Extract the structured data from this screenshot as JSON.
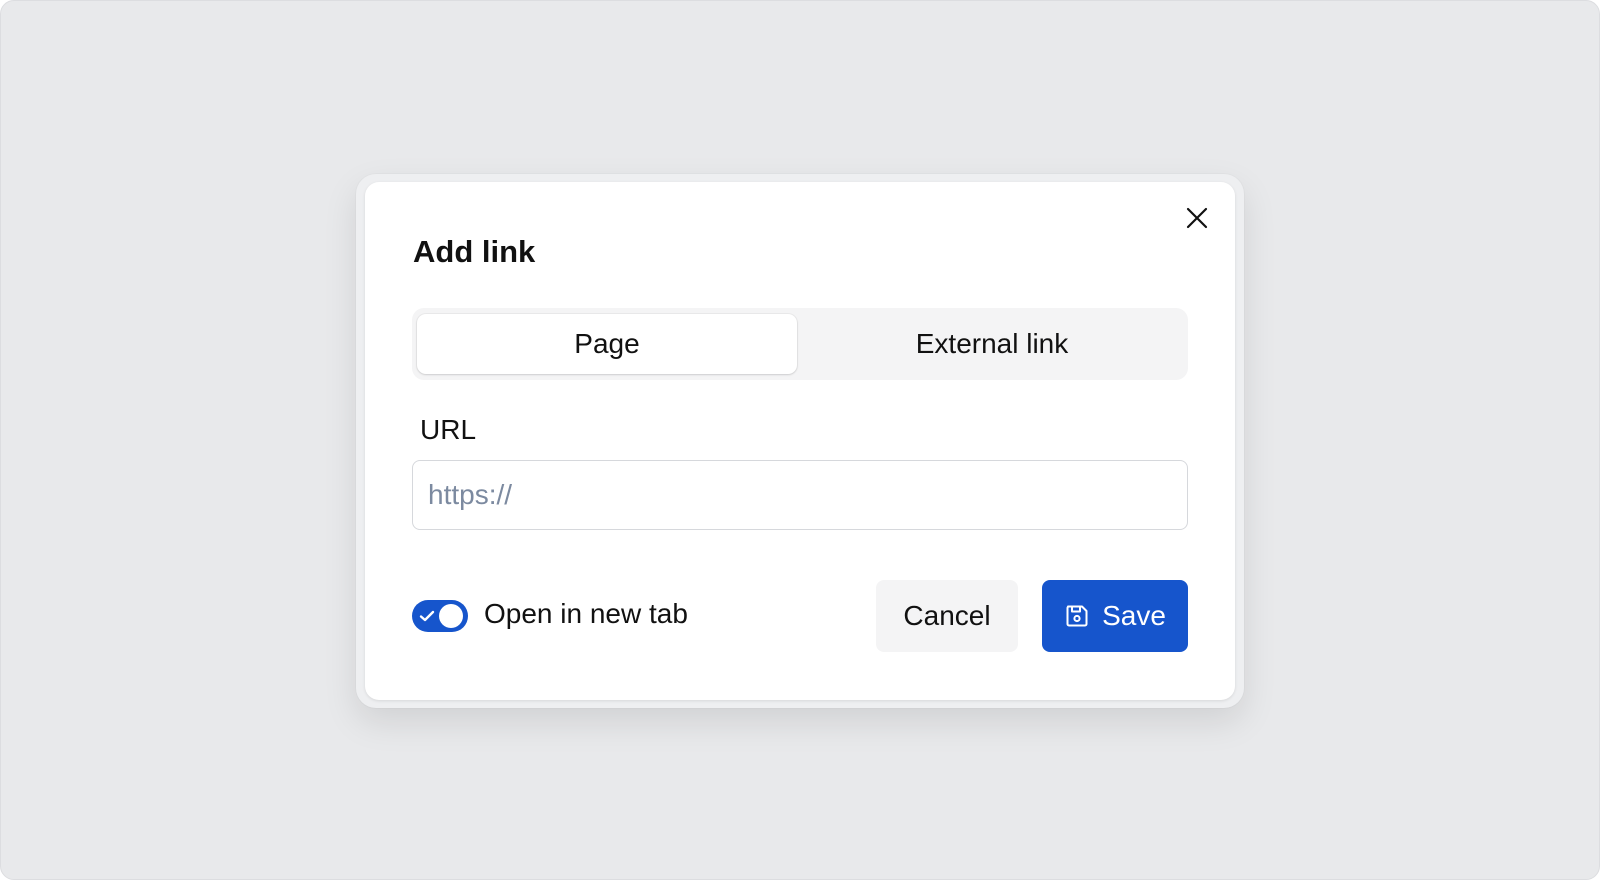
{
  "dialog": {
    "title": "Add link",
    "close_icon": "close-icon",
    "tabs": [
      {
        "label": "Page",
        "active": true
      },
      {
        "label": "External link",
        "active": false
      }
    ],
    "url_field": {
      "label": "URL",
      "value": "",
      "placeholder": "https://"
    },
    "open_in_new_tab": {
      "label": "Open in new tab",
      "checked": true,
      "icon": "check-icon"
    },
    "actions": {
      "cancel_label": "Cancel",
      "save_label": "Save",
      "save_icon": "save-icon"
    }
  },
  "colors": {
    "primary": "#1655cc",
    "backdrop": "#e8e9eb",
    "surface": "#ffffff",
    "muted_surface": "#f4f4f5",
    "placeholder": "#7c8aa0"
  }
}
